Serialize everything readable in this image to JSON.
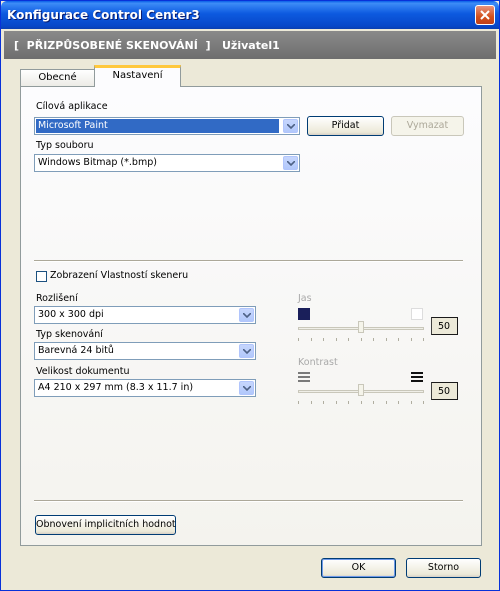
{
  "window": {
    "title": "Konfigurace Control Center3"
  },
  "header": {
    "text": "[  PŘIZPŮSOBENÉ SKENOVÁNÍ  ]   Uživatel1"
  },
  "tabs": [
    {
      "label": "Obecné",
      "selected": false
    },
    {
      "label": "Nastavení",
      "selected": true
    }
  ],
  "target_app": {
    "label": "Cílová aplikace",
    "value": "Microsoft Paint",
    "add_label": "Přidat",
    "remove_label": "Vymazat"
  },
  "file_type": {
    "label": "Typ souboru",
    "value": "Windows Bitmap (*.bmp)"
  },
  "show_scanner_props": {
    "label": "Zobrazení Vlastností skeneru",
    "checked": false
  },
  "resolution": {
    "label": "Rozlišení",
    "value": "300 x 300 dpi"
  },
  "scan_type": {
    "label": "Typ skenování",
    "value": "Barevná 24 bitů"
  },
  "doc_size": {
    "label": "Velikost dokumentu",
    "value": "A4 210 x 297 mm (8.3 x 11.7 in)"
  },
  "brightness": {
    "label": "Jas",
    "value": "50",
    "level_percent": 50
  },
  "contrast": {
    "label": "Kontrast",
    "value": "50",
    "level_percent": 50
  },
  "restore_defaults_label": "Obnovení implicitních hodnot",
  "ok_label": "OK",
  "cancel_label": "Storno",
  "colors": {
    "title_blue": "#0a5fe8",
    "header_gray": "#7a7a7a",
    "selection_blue": "#316ac5",
    "tab_accent": "#ffc83c"
  }
}
